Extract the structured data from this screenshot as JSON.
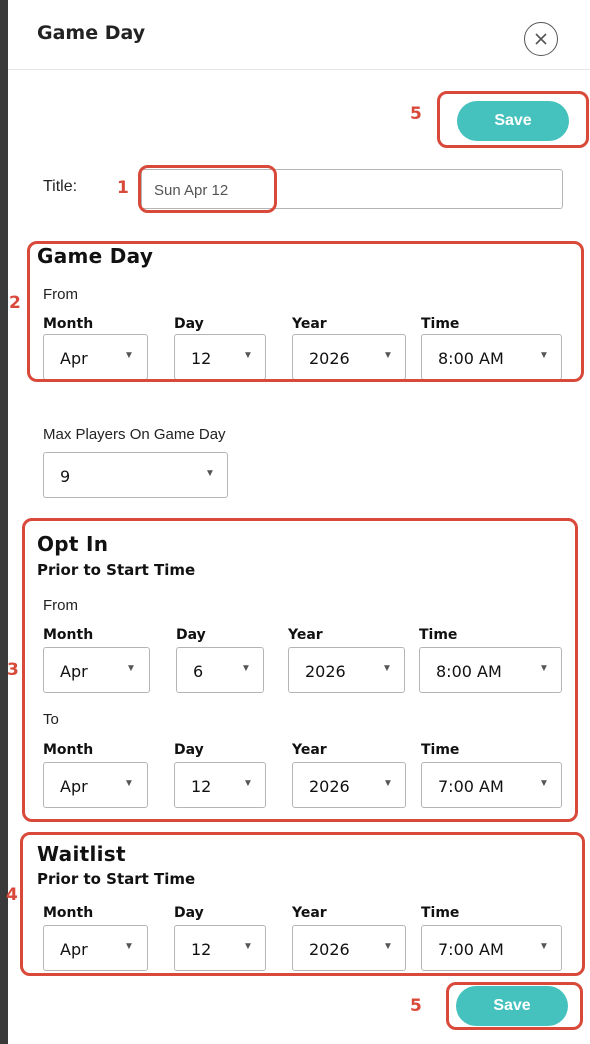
{
  "header": {
    "title": "Game Day",
    "close_icon": "close-circle-icon"
  },
  "save_label": "Save",
  "annotations": {
    "a1": "1",
    "a2": "2",
    "a3": "3",
    "a4": "4",
    "a5": "5"
  },
  "title_field": {
    "label": "Title:",
    "value": "Sun Apr 12"
  },
  "gameday": {
    "heading": "Game Day",
    "from": "From",
    "month_label": "Month",
    "day_label": "Day",
    "year_label": "Year",
    "time_label": "Time",
    "month": "Apr",
    "day": "12",
    "year": "2026",
    "time": "8:00 AM"
  },
  "max_players": {
    "label": "Max Players On Game Day",
    "value": "9"
  },
  "optin": {
    "heading": "Opt In",
    "sub": "Prior to Start Time",
    "from": "From",
    "to": "To",
    "month_label": "Month",
    "day_label": "Day",
    "year_label": "Year",
    "time_label": "Time",
    "from_month": "Apr",
    "from_day": "6",
    "from_year": "2026",
    "from_time": "8:00 AM",
    "to_month": "Apr",
    "to_day": "12",
    "to_year": "2026",
    "to_time": "7:00 AM"
  },
  "waitlist": {
    "heading": "Waitlist",
    "sub": "Prior to Start Time",
    "month_label": "Month",
    "day_label": "Day",
    "year_label": "Year",
    "time_label": "Time",
    "month": "Apr",
    "day": "12",
    "year": "2026",
    "time": "7:00 AM"
  },
  "colors": {
    "accent": "#45c1be",
    "annotation": "#d9493a"
  }
}
